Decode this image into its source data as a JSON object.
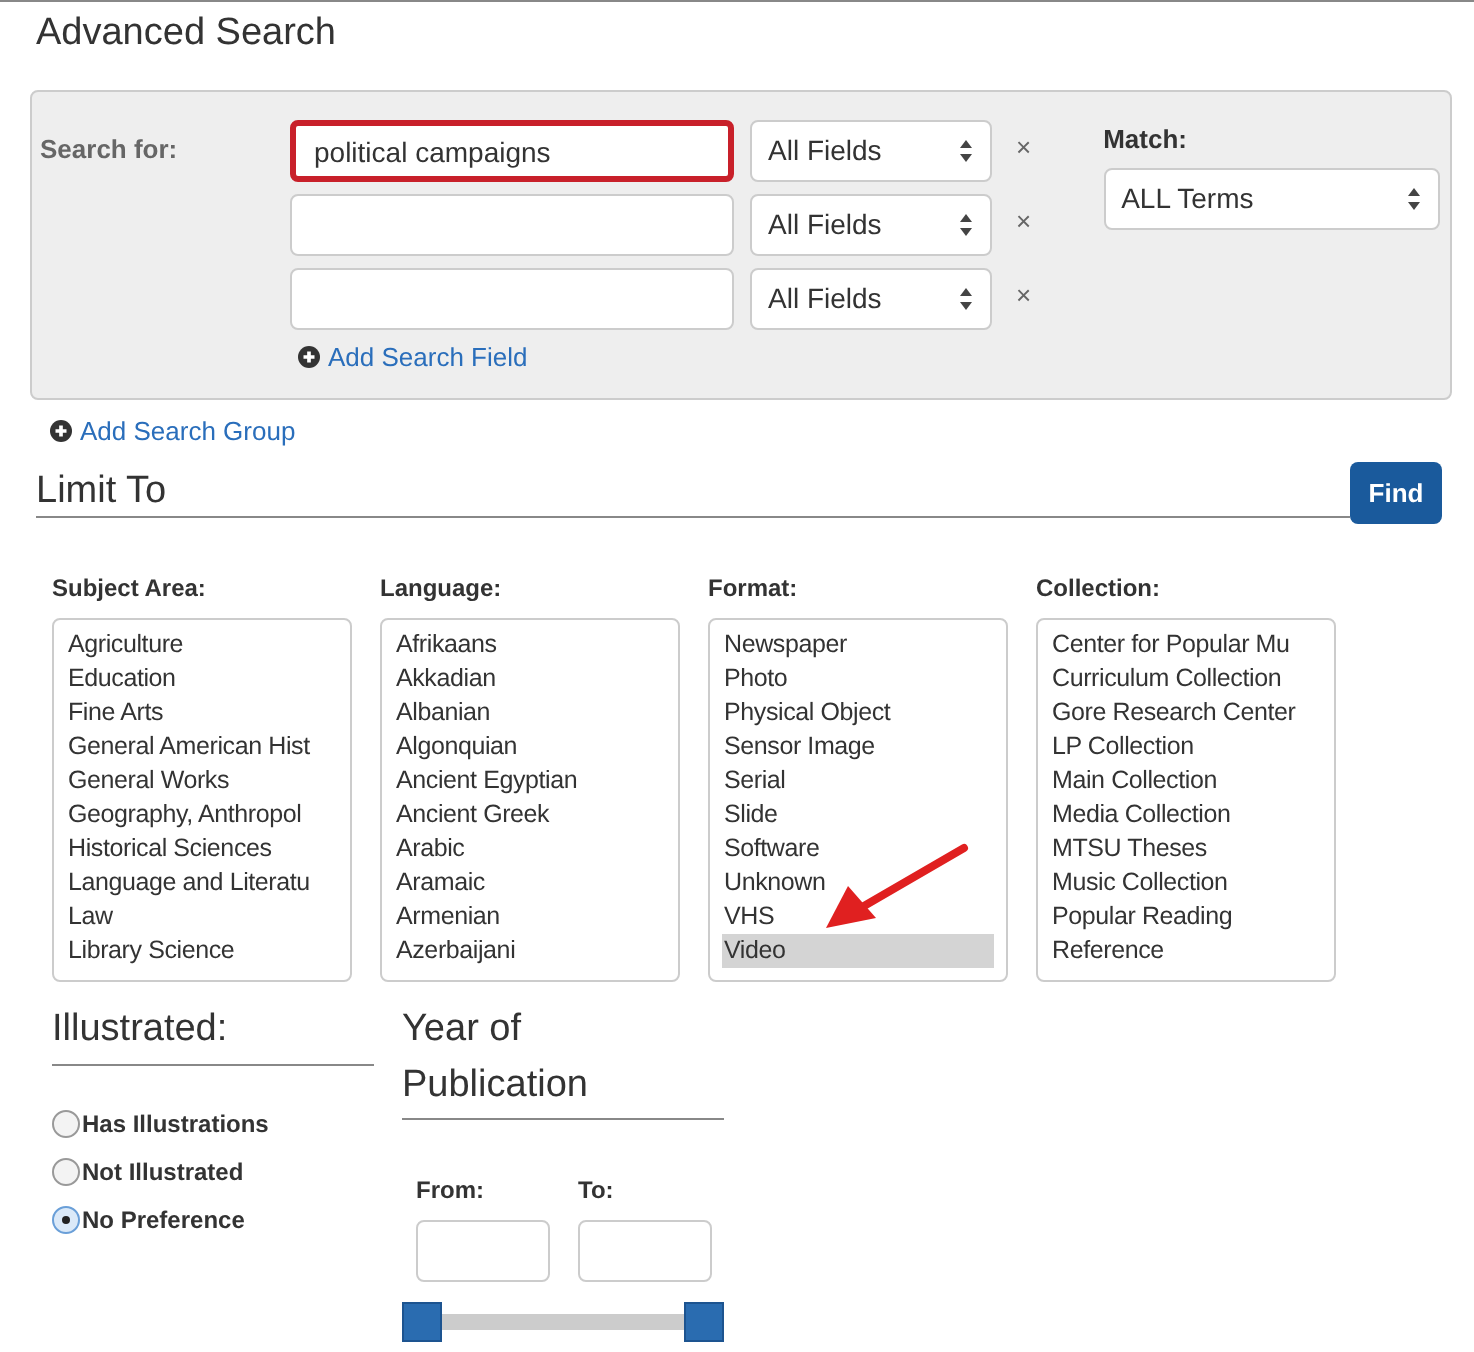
{
  "title": "Advanced Search",
  "search": {
    "label": "Search for:",
    "rows": [
      {
        "value": "political campaigns",
        "field": "All Fields",
        "focused": true,
        "remove": "×"
      },
      {
        "value": "",
        "field": "All Fields",
        "focused": false,
        "remove": "×"
      },
      {
        "value": "",
        "field": "All Fields",
        "focused": false,
        "remove": "×"
      }
    ],
    "add_field": "Add Search Field",
    "match_label": "Match:",
    "match": "ALL Terms"
  },
  "add_group": "Add Search Group",
  "limit_title": "Limit To",
  "find_button": "Find",
  "lists": [
    {
      "label": "Subject Area:",
      "items": [
        {
          "text": "Agriculture",
          "selected": false
        },
        {
          "text": "Education",
          "selected": false
        },
        {
          "text": "Fine Arts",
          "selected": false
        },
        {
          "text": "General American Hist",
          "selected": false
        },
        {
          "text": "General Works",
          "selected": false
        },
        {
          "text": "Geography, Anthropol",
          "selected": false
        },
        {
          "text": "Historical Sciences",
          "selected": false
        },
        {
          "text": "Language and Literatu",
          "selected": false
        },
        {
          "text": "Law",
          "selected": false
        },
        {
          "text": "Library Science",
          "selected": false
        }
      ]
    },
    {
      "label": "Language:",
      "items": [
        {
          "text": "Afrikaans",
          "selected": false
        },
        {
          "text": "Akkadian",
          "selected": false
        },
        {
          "text": "Albanian",
          "selected": false
        },
        {
          "text": "Algonquian",
          "selected": false
        },
        {
          "text": "Ancient Egyptian",
          "selected": false
        },
        {
          "text": "Ancient Greek",
          "selected": false
        },
        {
          "text": "Arabic",
          "selected": false
        },
        {
          "text": "Aramaic",
          "selected": false
        },
        {
          "text": "Armenian",
          "selected": false
        },
        {
          "text": "Azerbaijani",
          "selected": false
        }
      ]
    },
    {
      "label": "Format:",
      "items": [
        {
          "text": "Newspaper",
          "selected": false
        },
        {
          "text": "Photo",
          "selected": false
        },
        {
          "text": "Physical Object",
          "selected": false
        },
        {
          "text": "Sensor Image",
          "selected": false
        },
        {
          "text": "Serial",
          "selected": false
        },
        {
          "text": "Slide",
          "selected": false
        },
        {
          "text": "Software",
          "selected": false
        },
        {
          "text": "Unknown",
          "selected": false
        },
        {
          "text": "VHS",
          "selected": false
        },
        {
          "text": "Video",
          "selected": true
        }
      ]
    },
    {
      "label": "Collection:",
      "items": [
        {
          "text": "Center for Popular Mu",
          "selected": false
        },
        {
          "text": "Curriculum Collection",
          "selected": false
        },
        {
          "text": "Gore Research Center",
          "selected": false
        },
        {
          "text": "LP Collection",
          "selected": false
        },
        {
          "text": "Main Collection",
          "selected": false
        },
        {
          "text": "Media Collection",
          "selected": false
        },
        {
          "text": "MTSU Theses",
          "selected": false
        },
        {
          "text": "Music Collection",
          "selected": false
        },
        {
          "text": "Popular Reading",
          "selected": false
        },
        {
          "text": "Reference",
          "selected": false
        }
      ]
    }
  ],
  "illustrated": {
    "title": "Illustrated:",
    "options": [
      {
        "label": "Has Illustrations",
        "selected": false
      },
      {
        "label": "Not Illustrated",
        "selected": false
      },
      {
        "label": "No Preference",
        "selected": true
      }
    ]
  },
  "year": {
    "title_line1": "Year of",
    "title_line2": "Publication",
    "from_label": "From:",
    "to_label": "To:",
    "thumbs": [
      {
        "level": 0
      },
      {
        "level": 1
      }
    ]
  }
}
